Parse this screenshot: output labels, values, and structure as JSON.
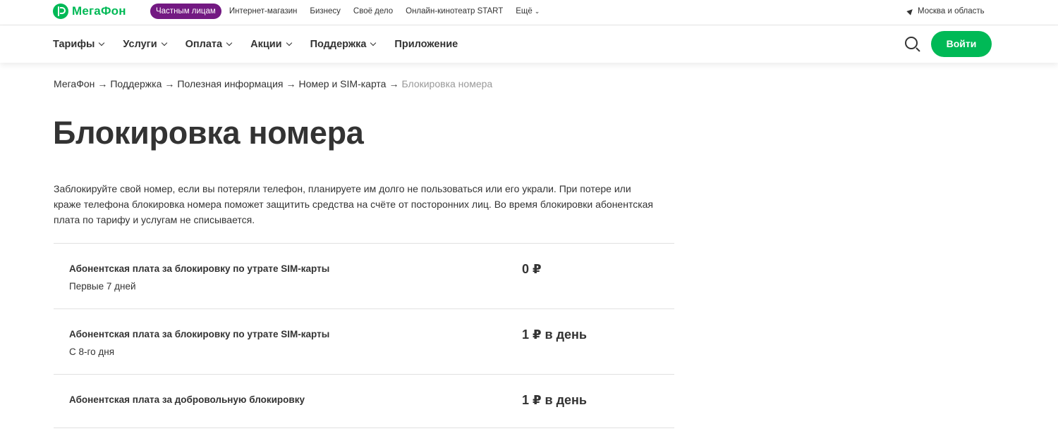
{
  "brand": {
    "name": "МегаФон",
    "color": "#00b956",
    "accent": "#731982",
    "logo_icon": "megafon-logo-icon"
  },
  "topbar": {
    "segments": [
      {
        "label": "Частным лицам",
        "active": true
      },
      {
        "label": "Интернет-магазин"
      },
      {
        "label": "Бизнесу"
      },
      {
        "label": "Своё дело"
      },
      {
        "label": "Онлайн-кинотеатр START"
      },
      {
        "label": "Ещё",
        "icon": "chevron-down-icon"
      }
    ],
    "region": {
      "label": "Москва и область",
      "icon": "location-arrow-icon"
    }
  },
  "header": {
    "nav": [
      {
        "label": "Тарифы",
        "has_dropdown": true
      },
      {
        "label": "Услуги",
        "has_dropdown": true
      },
      {
        "label": "Оплата",
        "has_dropdown": true
      },
      {
        "label": "Акции",
        "has_dropdown": true
      },
      {
        "label": "Поддержка",
        "has_dropdown": true
      },
      {
        "label": "Приложение",
        "has_dropdown": false
      }
    ],
    "search_icon": "search-icon",
    "login_label": "Войти"
  },
  "breadcrumb": {
    "items": [
      "МегаФон",
      "Поддержка",
      "Полезная информация",
      "Номер и SIM-карта",
      "Блокировка номера"
    ],
    "separator": "→"
  },
  "page": {
    "title": "Блокировка номера",
    "intro_lines": [
      "Заблокируйте свой номер, если вы потеряли телефон, планируете им долго не пользоваться или его украли. При потере или",
      "краже телефона блокировка номера поможет защитить средства на счёте от посторонних лиц. Во время блокировки абонентская",
      "плата по тарифу и услугам не списывается."
    ]
  },
  "prices": [
    {
      "label": "Абонентская плата за блокировку по утрате SIM-карты",
      "sub": "Первые 7 дней",
      "value": "0 ₽"
    },
    {
      "label": "Абонентская плата за блокировку по утрате SIM-карты",
      "sub": "С 8-го дня",
      "value": "1 ₽ в день"
    },
    {
      "label": "Абонентская плата за добровольную блокировку",
      "sub": "",
      "value": "1 ₽ в день"
    }
  ]
}
